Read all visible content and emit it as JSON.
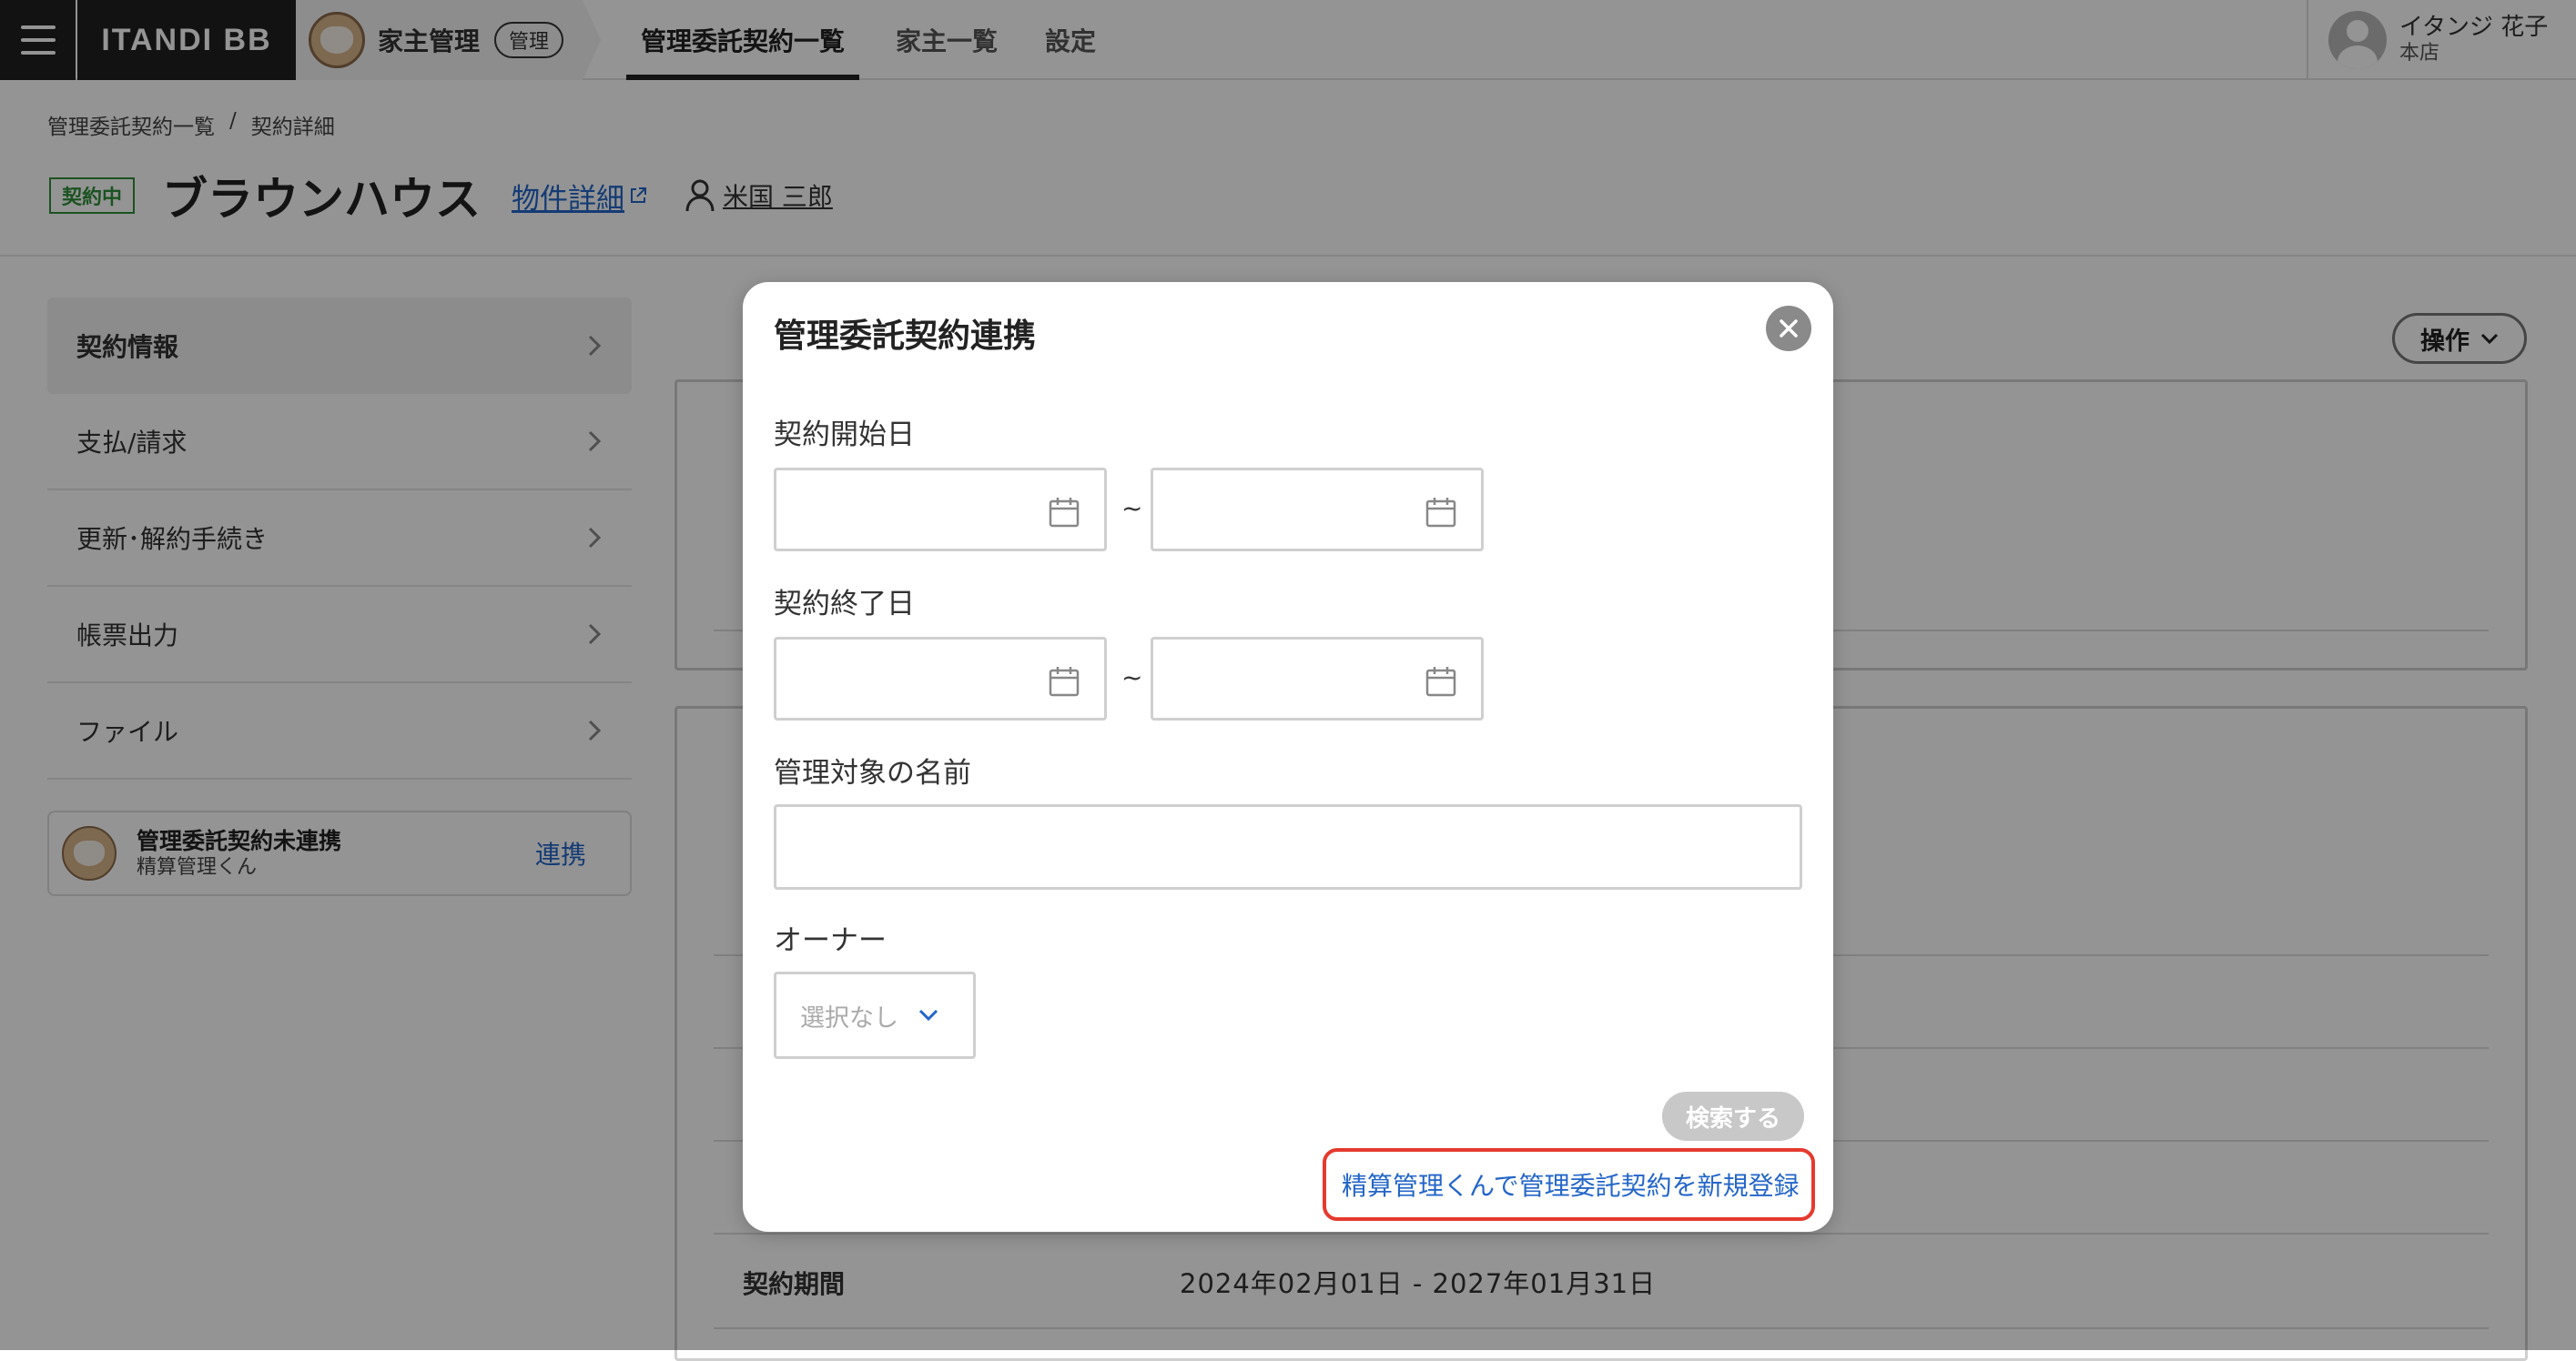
{
  "header": {
    "brand": "ITANDI BB",
    "app_name": "家主管理",
    "app_badge": "管理",
    "tabs": [
      {
        "label": "管理委託契約一覧",
        "active": true
      },
      {
        "label": "家主一覧",
        "active": false
      },
      {
        "label": "設定",
        "active": false
      }
    ],
    "user": {
      "name": "イタンジ 花子",
      "branch": "本店"
    }
  },
  "breadcrumb": {
    "items": [
      "管理委託契約一覧",
      "契約詳細"
    ],
    "separator": "/"
  },
  "title": {
    "status": "契約中",
    "name": "ブラウンハウス",
    "property_link": "物件詳細",
    "owner": "米国 三郎"
  },
  "sidebar": {
    "items": [
      {
        "label": "契約情報",
        "active": true
      },
      {
        "label": "支払/請求",
        "active": false
      },
      {
        "label": "更新･解約手続き",
        "active": false
      },
      {
        "label": "帳票出力",
        "active": false
      },
      {
        "label": "ファイル",
        "active": false
      }
    ],
    "link_card": {
      "title": "管理委託契約未連携",
      "subtitle": "精算管理くん",
      "action": "連携"
    }
  },
  "main": {
    "ops_button": "操作",
    "period_label": "契約期間",
    "period_value": "2024年02月01日 - 2027年01月31日"
  },
  "modal": {
    "title": "管理委託契約連携",
    "start_date_label": "契約開始日",
    "end_date_label": "契約終了日",
    "range_separator": "~",
    "name_label": "管理対象の名前",
    "owner_label": "オーナー",
    "owner_select_value": "選択なし",
    "search_button": "検索する",
    "register_link": "精算管理くんで管理委託契約を新規登録"
  },
  "colors": {
    "link": "#2466c8",
    "status_green": "#2f8f3a",
    "highlight_red": "#e53a2e",
    "header_dark": "#1f1f1f"
  }
}
